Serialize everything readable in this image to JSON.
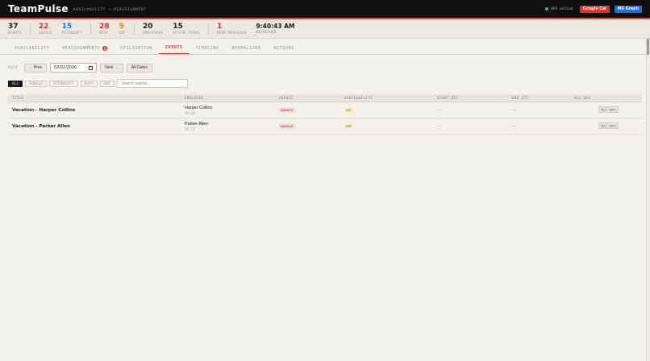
{
  "header": {
    "brand": "TeamPulse",
    "subtitle": "AVAILABILITY + REASSIGNMENT",
    "api_status": "API online",
    "google_btn": "Google Cal",
    "ms_btn": "MS Graph"
  },
  "stats": {
    "events": {
      "value": "37",
      "label": "EVENTS"
    },
    "google": {
      "value": "22",
      "label": "GOOGLE"
    },
    "microsoft": {
      "value": "15",
      "label": "MICROSOFT"
    },
    "busy": {
      "value": "28",
      "label": "BUSY"
    },
    "oof": {
      "value": "9",
      "label": "OOF"
    },
    "employees": {
      "value": "20",
      "label": "EMPLOYEES"
    },
    "active_tasks": {
      "value": "15",
      "label": "ACTIVE TASKS"
    },
    "need_reassign": {
      "value": "1",
      "label": "NEED REASSIGN"
    },
    "refreshed": {
      "value": "9:40:43 AM",
      "label": "REFRESHED"
    }
  },
  "tabs": [
    {
      "label": "AVAILABILITY"
    },
    {
      "label": "REASSIGNMENTS",
      "badge": "1"
    },
    {
      "label": "UTILIZATION"
    },
    {
      "label": "EVENTS"
    },
    {
      "label": "TIMELINE"
    },
    {
      "label": "NORMALIZED"
    },
    {
      "label": "ACTIONS"
    }
  ],
  "date_row": {
    "label": "DATE",
    "prev": "← Prev",
    "date_value": "02/22/2026",
    "next": "Next →",
    "all_dates": "All Dates"
  },
  "filters": [
    "ALL",
    "GOOGLE",
    "MICROSOFT",
    "BUSY",
    "OOF"
  ],
  "search": {
    "placeholder": "Search events..."
  },
  "table": {
    "headers": [
      "TITLE",
      "EMPLOYEE",
      "SOURCE",
      "AVAILABILITY",
      "START UTC",
      "END UTC",
      "ALL DAY"
    ],
    "rows": [
      {
        "title": "Vacation - Harper Collins",
        "employee": "Harper Collins",
        "emp_id": "ID:14",
        "source": "GOOGLE",
        "availability": "OOF",
        "start": "—",
        "end": "—",
        "all_day": "ALL DAY"
      },
      {
        "title": "Vacation - Parker Allen",
        "employee": "Parker Allen",
        "emp_id": "ID:17",
        "source": "GOOGLE",
        "availability": "OOF",
        "start": "—",
        "end": "—",
        "all_day": "ALL DAY"
      }
    ]
  },
  "colors": {
    "accent": "#d9362b",
    "microsoft": "#1e6fd9",
    "oof": "#e68a00",
    "online": "#3fbf5f"
  }
}
